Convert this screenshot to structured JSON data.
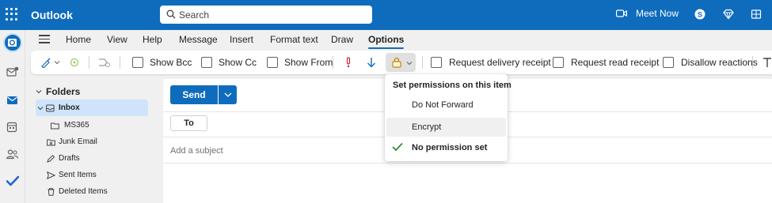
{
  "app": {
    "name": "Outlook"
  },
  "search": {
    "placeholder": "Search"
  },
  "topbar": {
    "meet_now": "Meet Now"
  },
  "ribbon": {
    "tabs": [
      "Home",
      "View",
      "Help",
      "Message",
      "Insert",
      "Format text",
      "Draw",
      "Options"
    ],
    "active_tab": "Options",
    "checkboxes": [
      "Show Bcc",
      "Show Cc",
      "Show From",
      "Request delivery receipt",
      "Request read receipt",
      "Disallow reactions"
    ]
  },
  "folders": {
    "header": "Folders",
    "items": [
      "Inbox",
      "MS365",
      "Junk Email",
      "Drafts",
      "Sent Items",
      "Deleted Items"
    ],
    "selected": "Inbox"
  },
  "compose": {
    "send_label": "Send",
    "to_label": "To",
    "subject_placeholder": "Add a subject"
  },
  "permissions_menu": {
    "header": "Set permissions on this item",
    "items": [
      "Do Not Forward",
      "Encrypt",
      "No permission set"
    ],
    "hovered": "Encrypt",
    "checked": "No permission set"
  },
  "colors": {
    "accent": "#0f6cbd",
    "selected_folder": "#cfe4fa",
    "check": "#107c10"
  }
}
